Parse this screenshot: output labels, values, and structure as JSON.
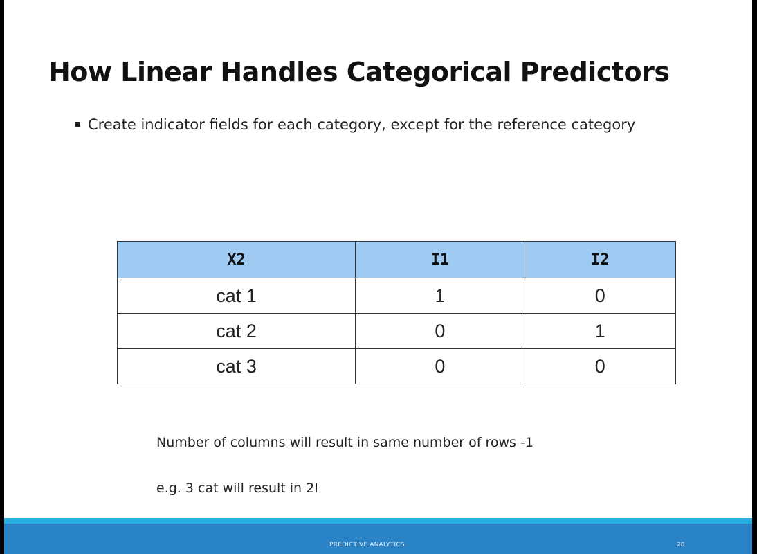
{
  "slide": {
    "title": "How Linear Handles Categorical Predictors",
    "bullet": "Create indicator fields for each category, except for the reference category",
    "table": {
      "headers": [
        "X2",
        "I1",
        "I2"
      ],
      "rows": [
        [
          "cat 1",
          "1",
          "0"
        ],
        [
          "cat 2",
          "0",
          "1"
        ],
        [
          "cat 3",
          "0",
          "0"
        ]
      ]
    },
    "note1": "Number of columns will result in same number of rows -1",
    "note2": "e.g. 3 cat will result in 2I",
    "footer": {
      "label": "PREDICTIVE ANALYTICS",
      "page_number": "28"
    }
  },
  "colors": {
    "header_fill": "#9fcbf3",
    "footer_bar": "#2a83c6",
    "footer_stripe": "#29aee2"
  }
}
